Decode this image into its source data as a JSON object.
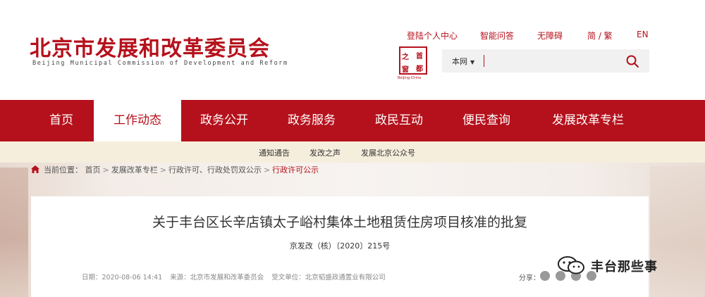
{
  "header": {
    "site_title": "北京市发展和改革委员会",
    "site_subtitle": "Beijing Municipal Commission of Development and Reform",
    "top_links": [
      "登陆个人中心",
      "智能问答",
      "无障碍",
      "简 / 繁",
      "EN"
    ],
    "seal_chars": [
      "之",
      "首",
      "窗",
      "都"
    ],
    "seal_caption": "Beijing-China",
    "search": {
      "scope_label": "本网",
      "input_value": "",
      "placeholder": ""
    }
  },
  "nav": {
    "items": [
      "首页",
      "工作动态",
      "政务公开",
      "政务服务",
      "政民互动",
      "便民查询",
      "发展改革专栏"
    ],
    "active_index": 1
  },
  "subnav": {
    "items": [
      "通知通告",
      "发改之声",
      "发展北京公众号"
    ]
  },
  "breadcrumb": {
    "prefix": "当前位置：",
    "items": [
      "首页",
      "发展改革专栏",
      "行政许可、行政处罚双公示",
      "行政许可公示"
    ],
    "separator": ">"
  },
  "article": {
    "title": "关于丰台区长辛店镇太子峪村集体土地租赁住房项目核准的批复",
    "doc_number": "京发改（核）〔2020〕215号",
    "date": "日期：2020-08-06 14:41",
    "source": "来源：北京市发展和改革委员会",
    "recipient": "受文单位：北京韬盛政通置业有限公司",
    "share_label": "分享："
  },
  "watermark": {
    "text": "丰台那些事"
  },
  "colors": {
    "brand_red": "#b5111c",
    "subnav_bg": "#f6eedc",
    "search_bg": "#f1f1f1"
  }
}
